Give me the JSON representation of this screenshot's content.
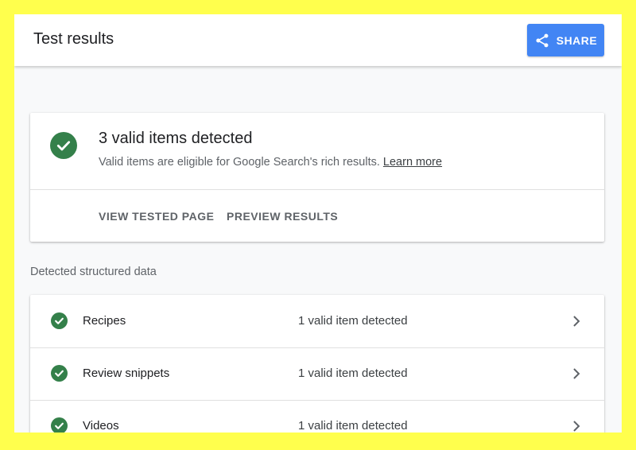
{
  "header": {
    "title": "Test results",
    "share_label": "SHARE"
  },
  "summary": {
    "title": "3 valid items detected",
    "subtitle": "Valid items are eligible for Google Search's rich results.",
    "learn_more": "Learn more",
    "actions": [
      "VIEW TESTED PAGE",
      "PREVIEW RESULTS"
    ]
  },
  "structured": {
    "label": "Detected structured data",
    "items": [
      {
        "name": "Recipes",
        "status": "1 valid item detected"
      },
      {
        "name": "Review snippets",
        "status": "1 valid item detected"
      },
      {
        "name": "Videos",
        "status": "1 valid item detected"
      }
    ]
  },
  "colors": {
    "accent": "#4285f4",
    "valid": "#34804a",
    "frame_border": "#ffff4d"
  },
  "icons": {
    "share": "share-icon",
    "valid": "check-circle-icon",
    "row_arrow": "chevron-right-icon"
  }
}
